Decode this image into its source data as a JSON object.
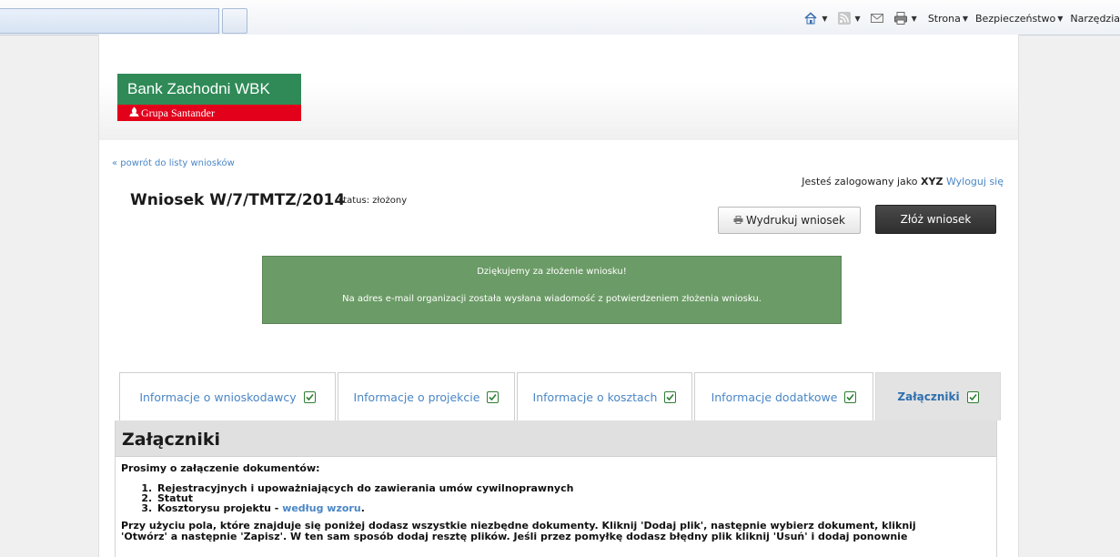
{
  "browser": {
    "menu": {
      "page": "Strona",
      "security": "Bezpieczeństwo",
      "tools": "Narzędzia"
    },
    "icons": [
      "home-icon",
      "rss-icon",
      "mail-icon",
      "print-icon"
    ]
  },
  "logo": {
    "bank_name": "Bank Zachodni WBK",
    "group_name": "Grupa Santander",
    "colors": {
      "green": "#2f8a57",
      "red": "#e3001b"
    }
  },
  "nav": {
    "back_link": "« powrót do listy wniosków"
  },
  "user": {
    "logged_in_prefix": "Jesteś zalogowany jako",
    "username": "XYZ",
    "logout": "Wyloguj się"
  },
  "application": {
    "title": "Wniosek W/7/TMTZ/2014",
    "status": "status: złożony"
  },
  "actions": {
    "print_label": "Wydrukuj wniosek",
    "submit_label": "Złóż wniosek"
  },
  "notice": {
    "line1": "Dziękujemy za złożenie wniosku!",
    "line2": "Na adres e-mail organizacji została wysłana wiadomość z potwierdzeniem złożenia wniosku.",
    "color": "#6b9b66"
  },
  "tabs": [
    {
      "label": "Informacje o wnioskodawcy",
      "complete": true
    },
    {
      "label": "Informacje o projekcie",
      "complete": true
    },
    {
      "label": "Informacje o kosztach",
      "complete": true
    },
    {
      "label": "Informacje dodatkowe",
      "complete": true
    },
    {
      "label": "Załączniki",
      "complete": true,
      "active": true
    }
  ],
  "attachments": {
    "heading": "Załączniki",
    "intro": "Prosimy o załączenie dokumentów:",
    "documents": [
      "Rejestracyjnych i upoważniających do zawierania umów cywilnoprawnych",
      "Statut",
      "Kosztorysu projektu - "
    ],
    "template_link": "według wzoru",
    "template_suffix": ".",
    "instructions_line1": "Przy użyciu pola, które znajduje się poniżej dodasz wszystkie niezbędne dokumenty. Kliknij 'Dodaj plik', następnie wybierz dokument, kliknij",
    "instructions_line2": "'Otwórz' a następnie 'Zapisz'. W ten sam sposób dodaj resztę plików. Jeśli przez pomyłkę dodasz błędny plik kliknij 'Usuń' i dodaj ponownie"
  }
}
